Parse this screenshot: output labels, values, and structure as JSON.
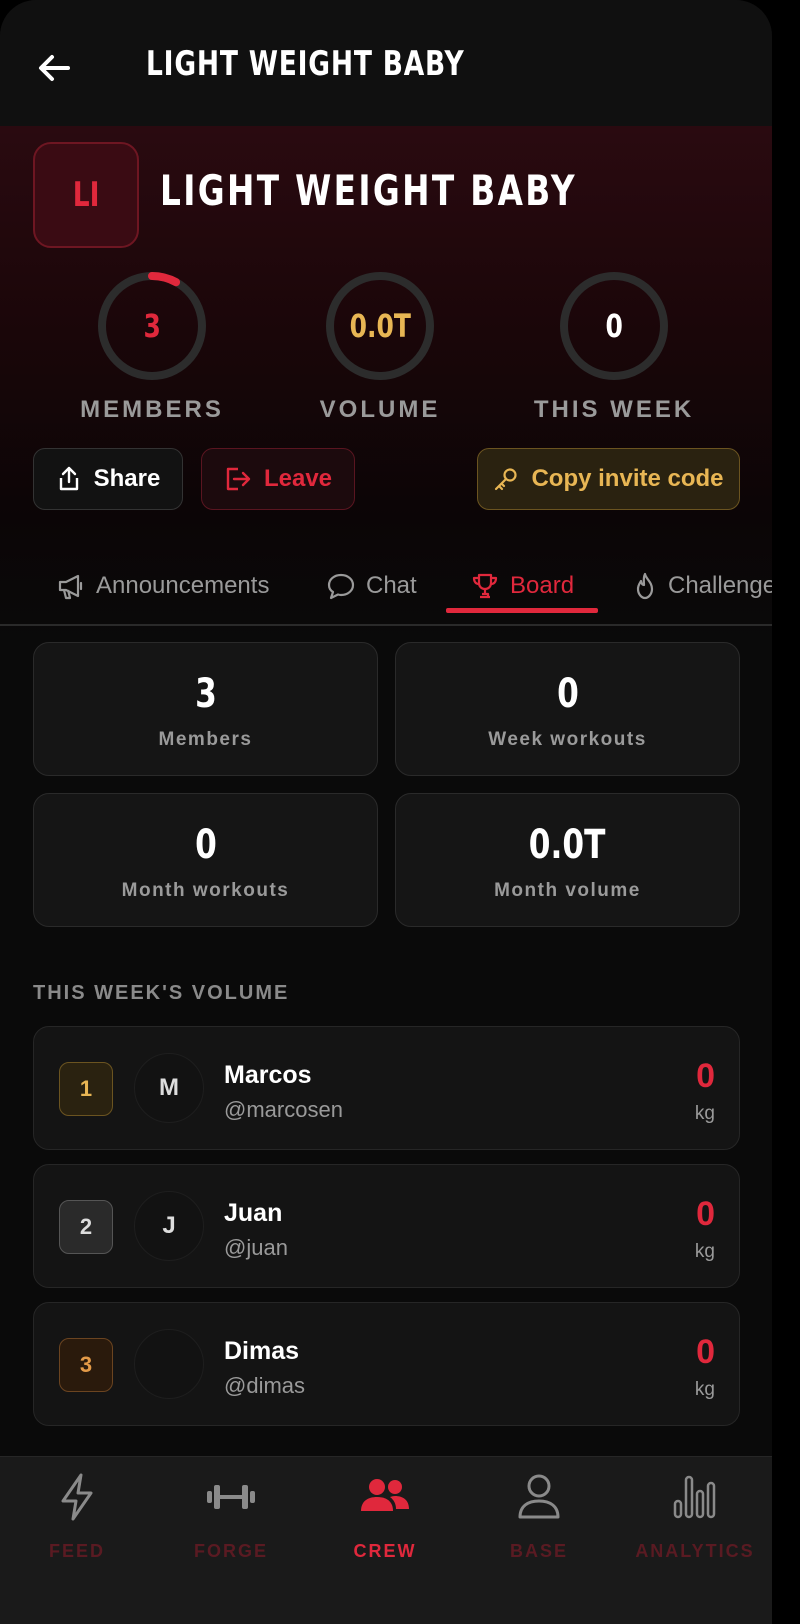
{
  "header": {
    "title": "LIGHT WEIGHT BABY"
  },
  "crew": {
    "initials": "LI",
    "name": "LIGHT WEIGHT BABY",
    "stats": [
      {
        "value": "3",
        "label": "MEMBERS",
        "color": "#e0283c",
        "progress": 0.08
      },
      {
        "value": "0.0T",
        "label": "VOLUME",
        "color": "#e8b654",
        "progress": 0
      },
      {
        "value": "0",
        "label": "THIS WEEK",
        "color": "#ffffff",
        "progress": 0
      }
    ]
  },
  "actions": {
    "share": "Share",
    "leave": "Leave",
    "invite": "Copy invite code"
  },
  "tabs": [
    {
      "label": "Announcements",
      "icon": "megaphone-icon"
    },
    {
      "label": "Chat",
      "icon": "chat-icon"
    },
    {
      "label": "Board",
      "icon": "trophy-icon",
      "active": true
    },
    {
      "label": "Challenges",
      "icon": "flame-icon"
    }
  ],
  "board": {
    "cards": [
      {
        "value": "3",
        "label": "Members"
      },
      {
        "value": "0",
        "label": "Week workouts"
      },
      {
        "value": "0",
        "label": "Month workouts"
      },
      {
        "value": "0.0T",
        "label": "Month volume"
      }
    ],
    "section_title": "THIS WEEK'S VOLUME",
    "leaderboard": [
      {
        "rank": "1",
        "initial": "M",
        "name": "Marcos",
        "handle": "@marcosen",
        "value": "0",
        "unit": "kg"
      },
      {
        "rank": "2",
        "initial": "J",
        "name": "Juan",
        "handle": "@juan",
        "value": "0",
        "unit": "kg"
      },
      {
        "rank": "3",
        "initial": "",
        "name": "Dimas",
        "handle": "@dimas",
        "value": "0",
        "unit": "kg"
      }
    ]
  },
  "nav": [
    {
      "label": "FEED",
      "icon": "bolt-icon"
    },
    {
      "label": "FORGE",
      "icon": "dumbbell-icon"
    },
    {
      "label": "CREW",
      "icon": "users-icon",
      "active": true
    },
    {
      "label": "BASE",
      "icon": "user-icon"
    },
    {
      "label": "ANALYTICS",
      "icon": "bar-chart-icon"
    }
  ],
  "colors": {
    "accent": "#e0283c",
    "gold": "#e8b654",
    "background": "#0a0a0a"
  }
}
